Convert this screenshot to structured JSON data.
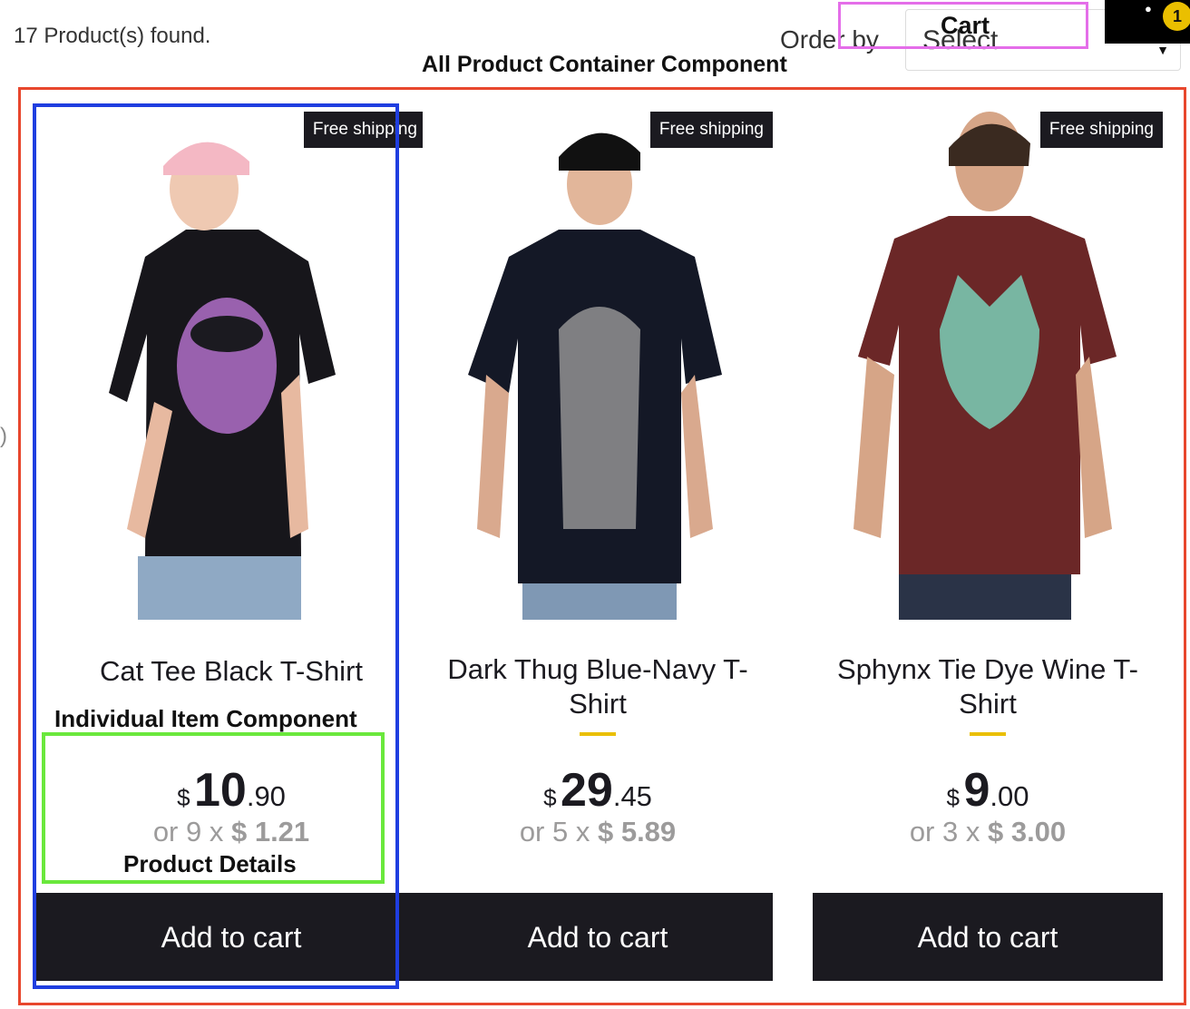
{
  "header": {
    "found_text": "17 Product(s) found.",
    "order_by_label": "Order by",
    "order_select_value": "Select",
    "cart_label": "Cart",
    "cart_count": "1"
  },
  "annotations": {
    "all_products": "All Product Container Component",
    "individual_item": "Individual Item Component",
    "product_details": "Product Details",
    "colors": {
      "container": "#e8472d",
      "item": "#1f3ee0",
      "details": "#6ae83c",
      "cart": "#e46ee9"
    }
  },
  "products": [
    {
      "title": "Cat Tee Black T-Shirt",
      "badge": "Free shipping",
      "currency": "$",
      "price_int": "10",
      "price_dec": ".90",
      "install_prefix": "or 9 x ",
      "install_value": "$ 1.21",
      "button": "Add to cart",
      "shirt_color": "#17161b"
    },
    {
      "title": "Dark Thug Blue-Navy T-Shirt",
      "badge": "Free shipping",
      "currency": "$",
      "price_int": "29",
      "price_dec": ".45",
      "install_prefix": "or 5 x ",
      "install_value": "$ 5.89",
      "button": "Add to cart",
      "shirt_color": "#141826"
    },
    {
      "title": "Sphynx Tie Dye Wine T-Shirt",
      "badge": "Free shipping",
      "currency": "$",
      "price_int": "9",
      "price_dec": ".00",
      "install_prefix": "or 3 x ",
      "install_value": "$ 3.00",
      "button": "Add to cart",
      "shirt_color": "#6b2727"
    }
  ],
  "colors": {
    "accent": "#eabf00",
    "dark": "#1b1a20",
    "muted": "#9c9b9b"
  }
}
